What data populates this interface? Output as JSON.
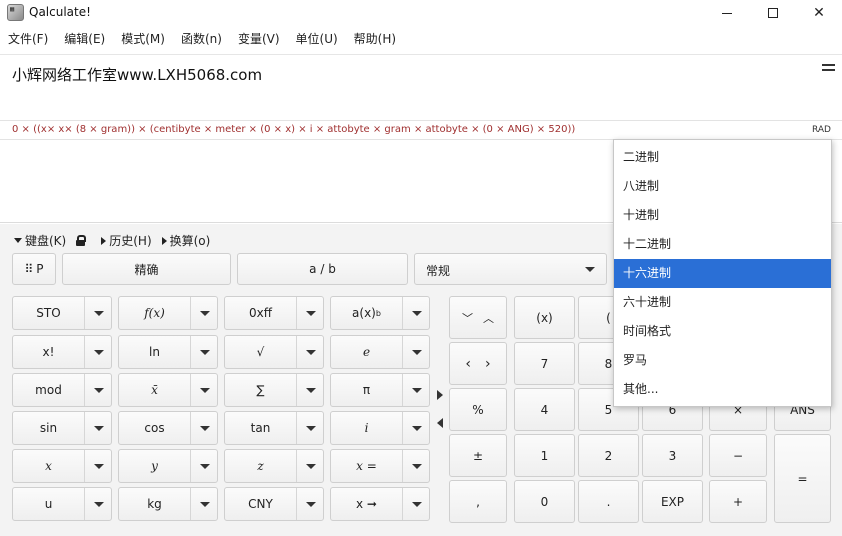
{
  "window": {
    "title": "Qalculate!"
  },
  "menu": [
    "文件(F)",
    "编辑(E)",
    "模式(M)",
    "函数(n)",
    "变量(V)",
    "单位(U)",
    "帮助(H)"
  ],
  "expression": "小辉网络工作室www.LXH5068.com",
  "parsed": "0 × ((x× x× (8 × gram)) × (centibyte × meter × (0 × x) × i × attobyte × gram × attobyte × (0 × ANG) × 520))",
  "angle_mode": "RAD",
  "toggles": {
    "keyboard": "键盘(K)",
    "history": "历史(H)",
    "convert": "换算(o)"
  },
  "topbar": {
    "p": "P",
    "exact": "精确",
    "fraction": "a / b",
    "format": "常规"
  },
  "functions": {
    "sto": "STO",
    "fx": "f(x)",
    "hex": "0xff",
    "ax": "a(x)",
    "fact": "x!",
    "ln": "ln",
    "sqrt": "√",
    "e": "e",
    "mod": "mod",
    "mean": "x̄",
    "sum": "∑",
    "pi": "π",
    "sin": "sin",
    "cos": "cos",
    "tan": "tan",
    "i": "i",
    "x": "x",
    "y": "y",
    "z": "z",
    "xeq": "x =",
    "u": "u",
    "kg": "kg",
    "cny": "CNY",
    "xto": "x ➞"
  },
  "keys": {
    "paren": "(x)",
    "paren2": "(",
    "percent": "%",
    "pm": "±",
    "comma": ",",
    "n7": "7",
    "n8": "8",
    "n4": "4",
    "n5": "5",
    "n6": "6",
    "n1": "1",
    "n2": "2",
    "n3": "3",
    "n0": "0",
    "dot": ".",
    "exp": "EXP",
    "times": "×",
    "minus": "−",
    "plus": "+",
    "ans": "ANS",
    "equals": "="
  },
  "dropdown": {
    "items": [
      "二进制",
      "八进制",
      "十进制",
      "十二进制",
      "十六进制",
      "六十进制",
      "时间格式",
      "罗马",
      "其他..."
    ],
    "selected_index": 4
  }
}
